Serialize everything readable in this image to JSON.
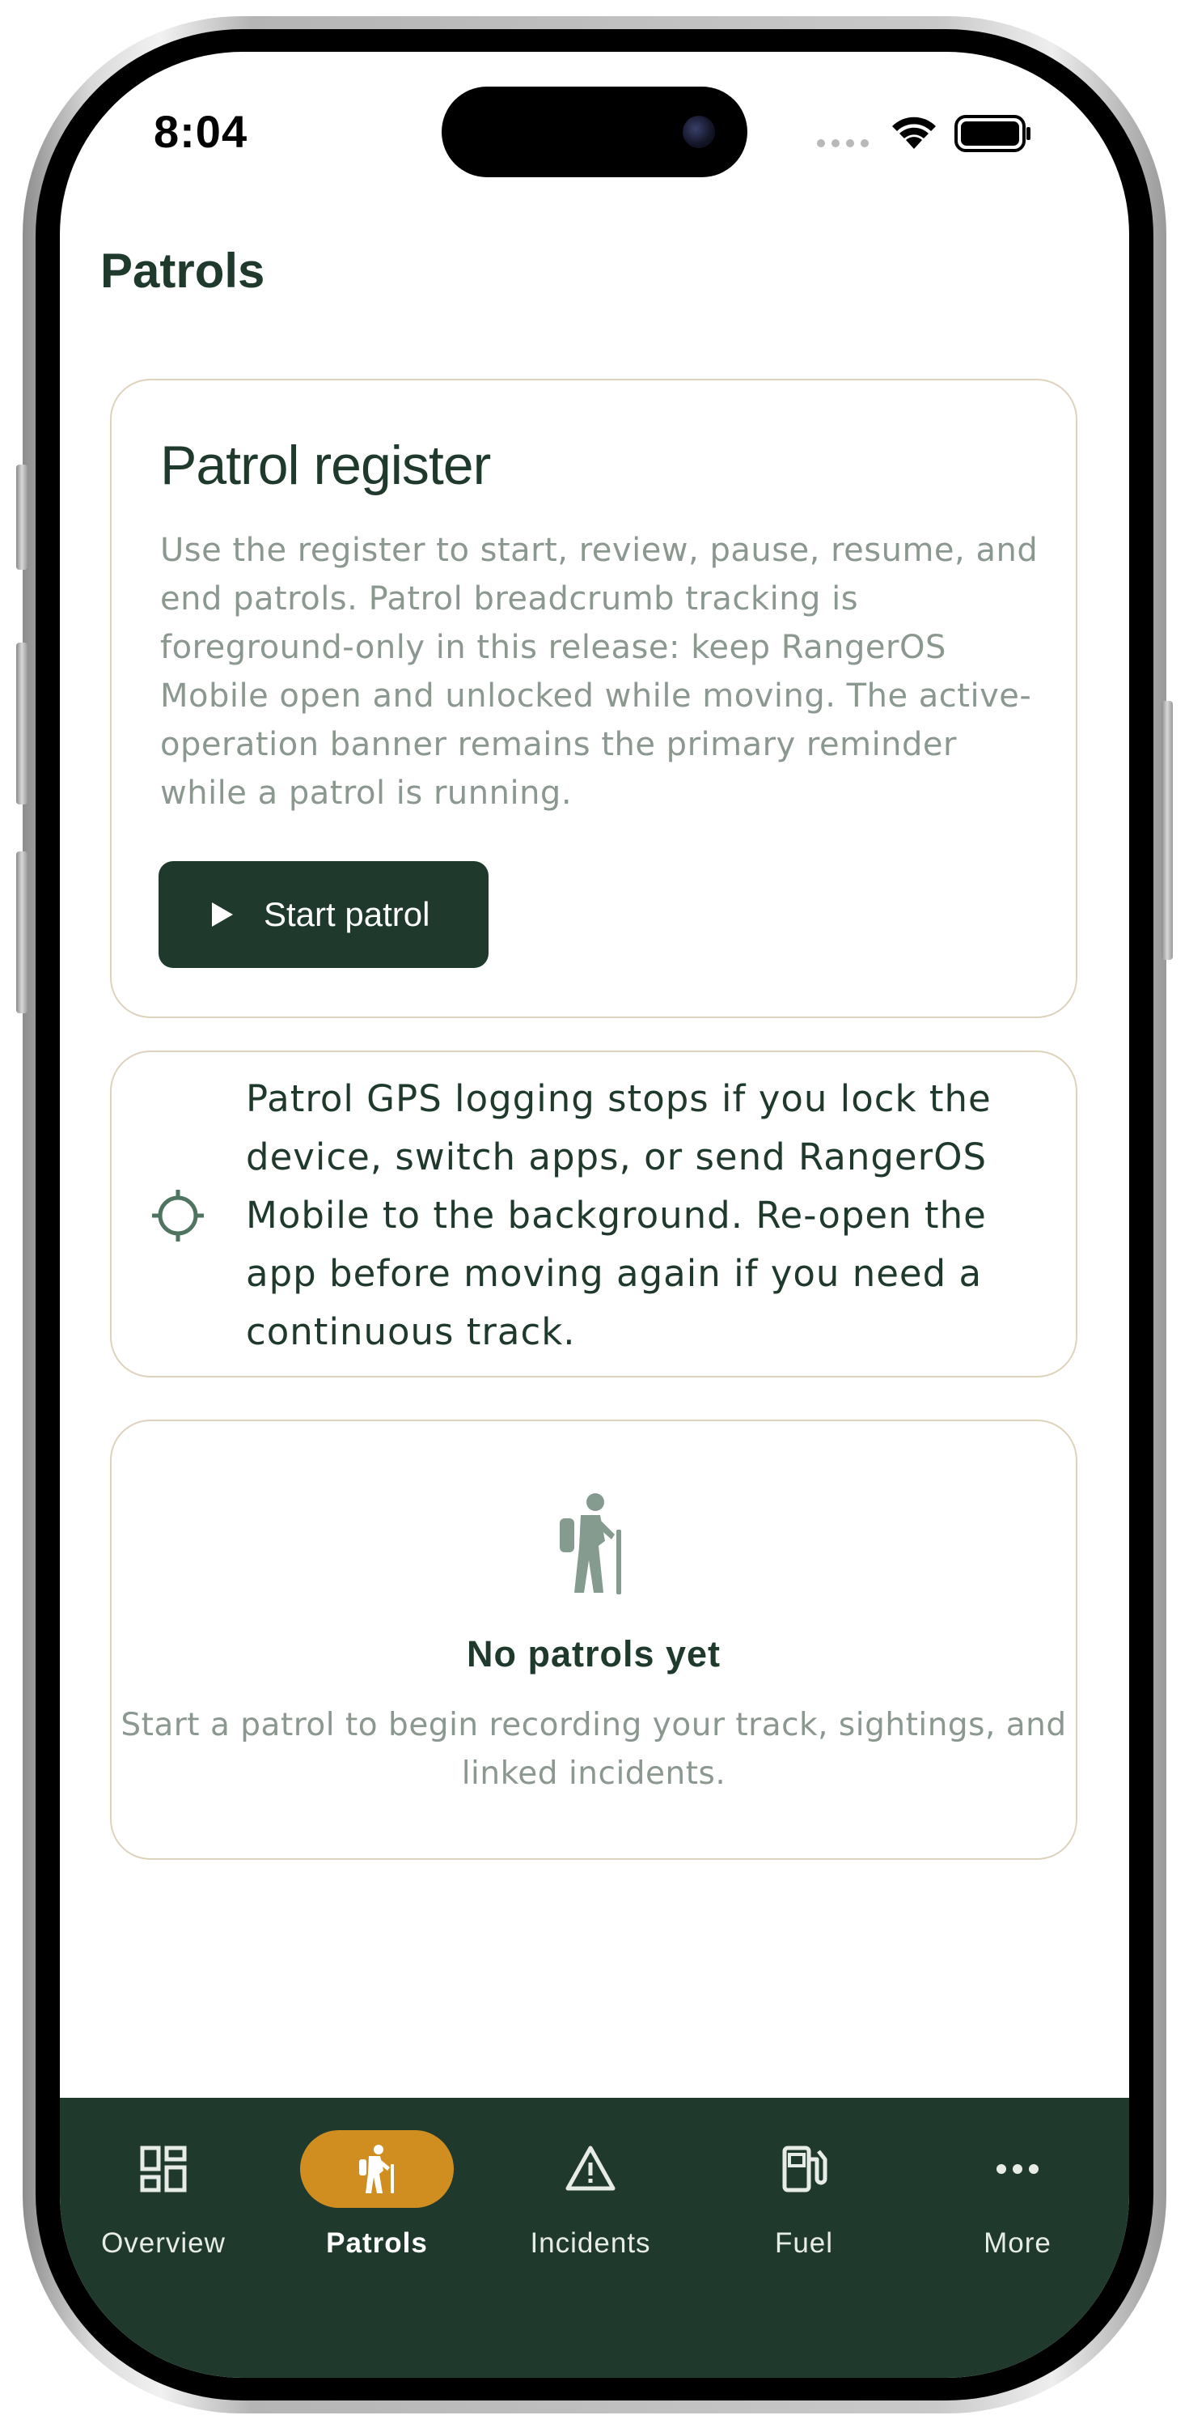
{
  "status_bar": {
    "time": "8:04"
  },
  "header": {
    "title": "Patrols"
  },
  "register_card": {
    "title": "Patrol register",
    "description": "Use the register to start, review, pause, resume, and end patrols. Patrol breadcrumb tracking is foreground-only in this release: keep RangerOS Mobile open and unlocked while moving. The active-operation banner remains the primary reminder while a patrol is running.",
    "start_button_label": "Start patrol",
    "start_button_icon": "play-icon"
  },
  "notice_card": {
    "icon": "crosshair-icon",
    "text": "Patrol GPS logging stops if you lock the device, switch apps, or send RangerOS Mobile to the background. Re-open the app before moving again if you need a continuous track."
  },
  "empty_state": {
    "icon": "hiker-icon",
    "title": "No patrols yet",
    "description": "Start a patrol to begin recording your track, sightings, and linked incidents."
  },
  "bottom_nav": {
    "items": [
      {
        "label": "Overview",
        "icon": "dashboard-icon",
        "active": false
      },
      {
        "label": "Patrols",
        "icon": "hiker-icon",
        "active": true
      },
      {
        "label": "Incidents",
        "icon": "warning-icon",
        "active": false
      },
      {
        "label": "Fuel",
        "icon": "fuel-pump-icon",
        "active": false
      },
      {
        "label": "More",
        "icon": "more-icon",
        "active": false
      }
    ]
  },
  "colors": {
    "brand_dark_green": "#1f3a2c",
    "accent_orange": "#d08e21",
    "muted_text": "#8b9890",
    "card_border": "#ddd3bd",
    "icon_green": "#4f7561"
  }
}
